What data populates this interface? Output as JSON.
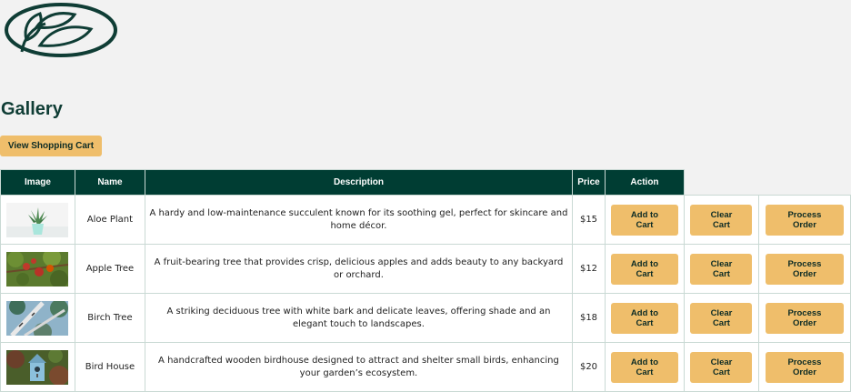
{
  "page": {
    "title": "Gallery",
    "cart_button": "View Shopping Cart"
  },
  "logo": {
    "icon": "leaf-logo-icon",
    "color": "#0f3d35"
  },
  "table": {
    "headers": [
      "Image",
      "Name",
      "Description",
      "Price",
      "Action"
    ],
    "header_bg": "#003d33",
    "button_color": "#efbe6b",
    "rows": [
      {
        "image": "aloe-plant-image",
        "name": "Aloe Plant",
        "description": "A hardy and low-maintenance succulent known for its soothing gel, perfect for skincare and home décor.",
        "price": "$15",
        "add": "Add to\nCart",
        "clear": "Clear\nCart",
        "process": "Process\nOrder"
      },
      {
        "image": "apple-tree-image",
        "name": "Apple Tree",
        "description": "A fruit-bearing tree that provides crisp, delicious apples and adds beauty to any backyard or orchard.",
        "price": "$12",
        "add": "Add to\nCart",
        "clear": "Clear\nCart",
        "process": "Process\nOrder"
      },
      {
        "image": "birch-tree-image",
        "name": "Birch Tree",
        "description": "A striking deciduous tree with white bark and delicate leaves, offering shade and an elegant touch to landscapes.",
        "price": "$18",
        "add": "Add to\nCart",
        "clear": "Clear\nCart",
        "process": "Process\nOrder"
      },
      {
        "image": "bird-house-image",
        "name": "Bird House",
        "description": "A handcrafted wooden birdhouse designed to attract and shelter small birds, enhancing your garden’s ecosystem.",
        "price": "$20",
        "add": "Add to\nCart",
        "clear": "Clear\nCart",
        "process": "Process\nOrder"
      }
    ]
  }
}
